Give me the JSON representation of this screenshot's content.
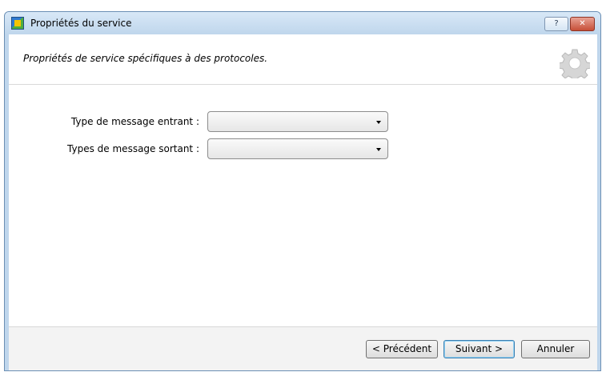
{
  "window": {
    "title": "Propriétés du service",
    "help_label": "?",
    "close_label": "✕"
  },
  "header": {
    "subtitle": "Propriétés de service spécifiques à des protocoles."
  },
  "form": {
    "incoming_label": "Type de message entrant :",
    "outgoing_label": "Types de message sortant :",
    "incoming_value": "",
    "outgoing_value": ""
  },
  "footer": {
    "previous_label": "< Précédent",
    "next_label": "Suivant >",
    "cancel_label": "Annuler"
  }
}
